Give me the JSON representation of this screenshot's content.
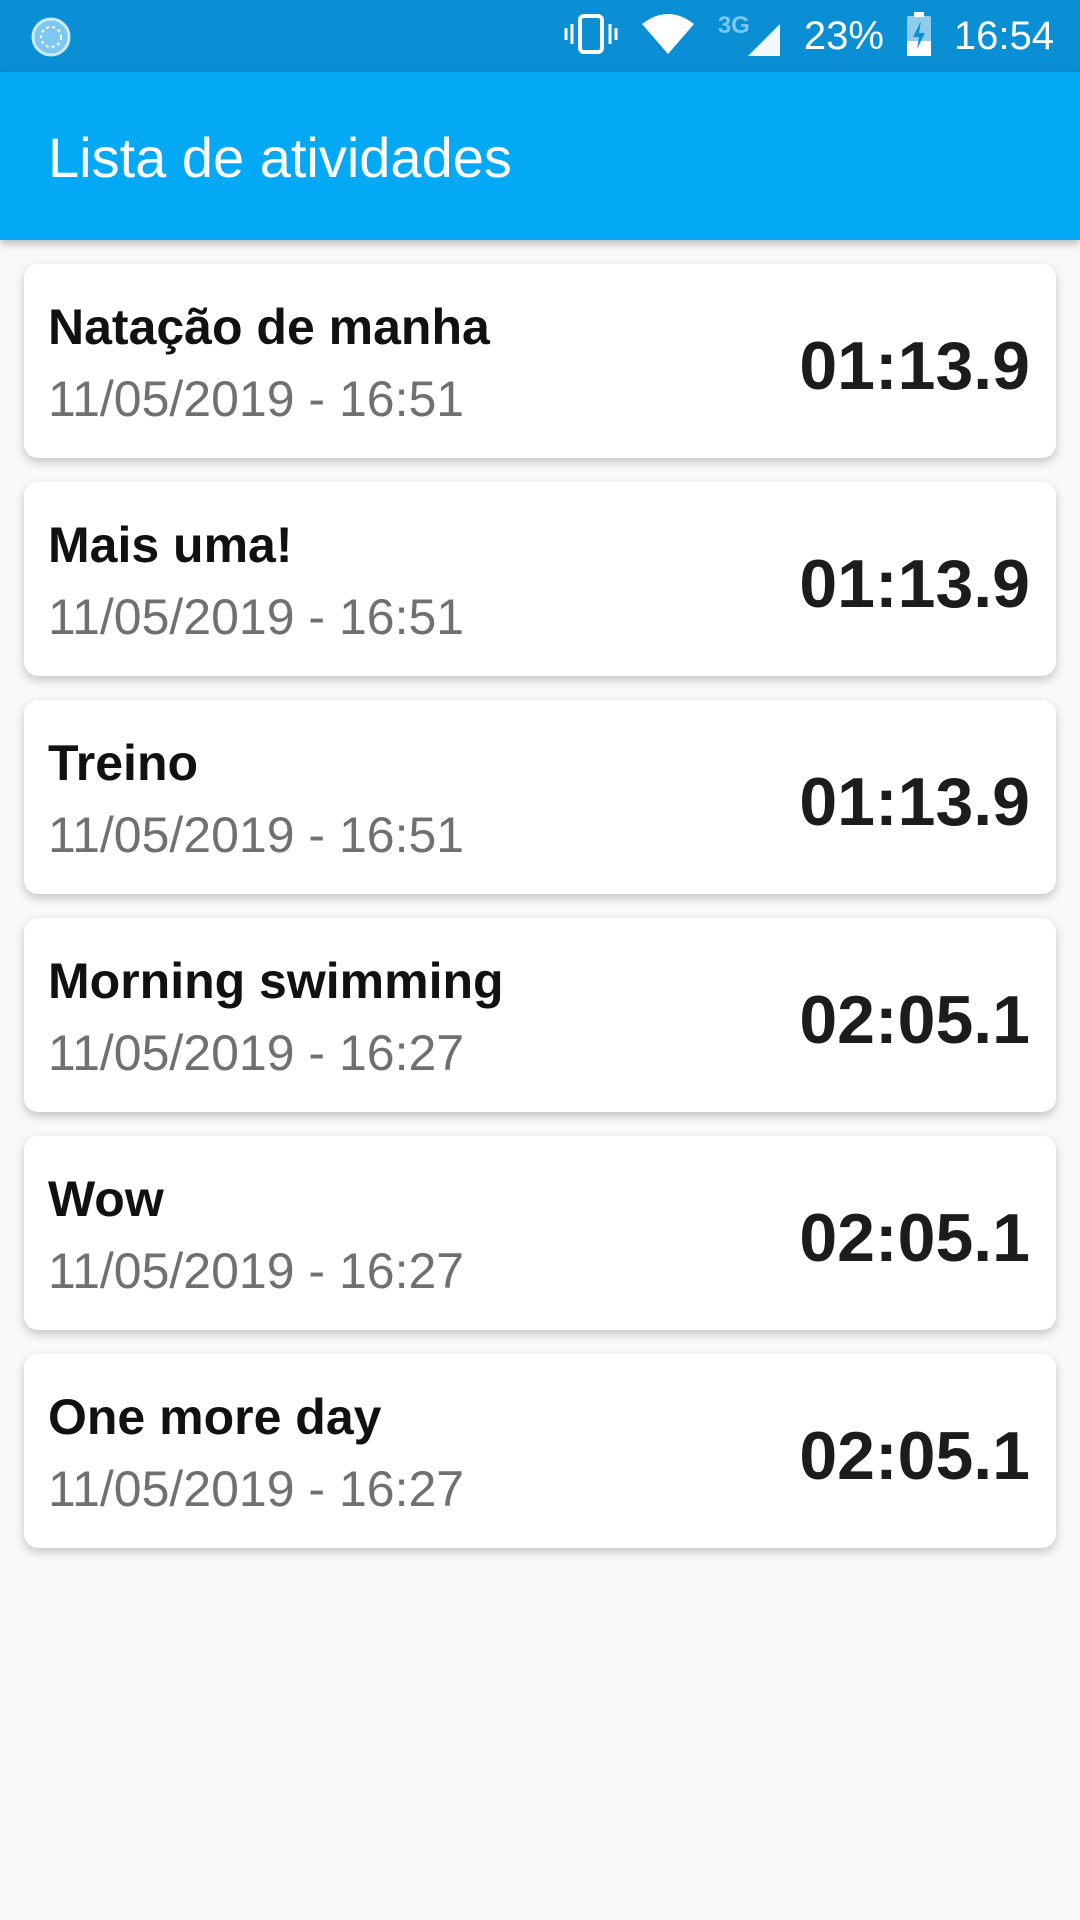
{
  "status_bar": {
    "left_icon": "loading-circle-icon",
    "icons": [
      "vibrate-icon",
      "wifi-icon",
      "signal-icon",
      "battery-charging-icon"
    ],
    "network_type": "3G",
    "battery_percent": "23%",
    "time": "16:54"
  },
  "app_bar": {
    "title": "Lista de atividades",
    "color": "#03a9f4"
  },
  "activities": [
    {
      "title": "Natação de manha",
      "datetime": "11/05/2019 - 16:51",
      "duration": "01:13.9"
    },
    {
      "title": "Mais uma!",
      "datetime": "11/05/2019 - 16:51",
      "duration": "01:13.9"
    },
    {
      "title": "Treino",
      "datetime": "11/05/2019 - 16:51",
      "duration": "01:13.9"
    },
    {
      "title": "Morning swimming",
      "datetime": "11/05/2019 - 16:27",
      "duration": "02:05.1"
    },
    {
      "title": "Wow",
      "datetime": "11/05/2019 - 16:27",
      "duration": "02:05.1"
    },
    {
      "title": "One more day",
      "datetime": "11/05/2019 - 16:27",
      "duration": "02:05.1"
    }
  ]
}
